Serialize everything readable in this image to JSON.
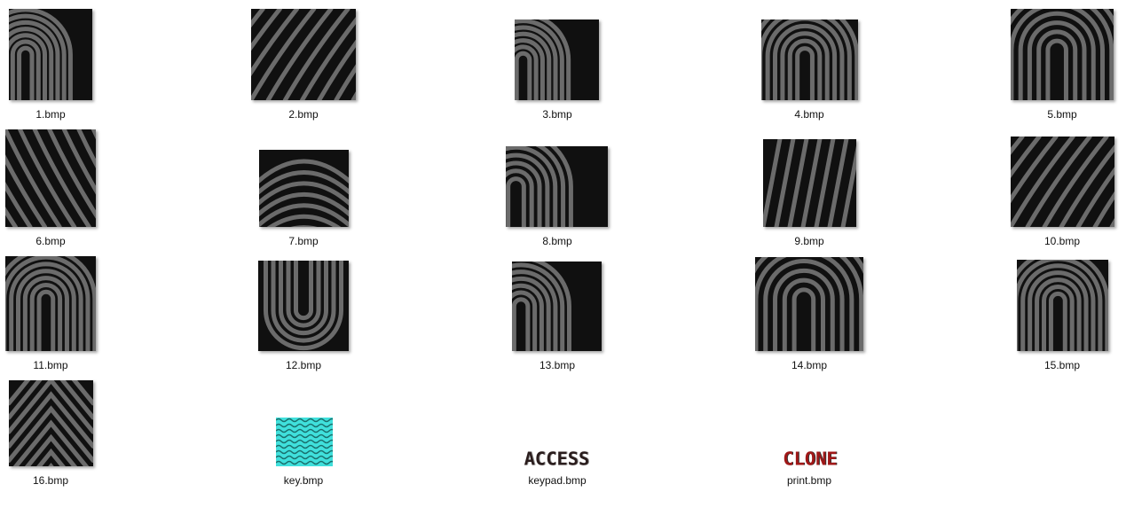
{
  "files": [
    {
      "name": "1.bmp",
      "icon": "fingerprint-icon",
      "pattern": "loop-left"
    },
    {
      "name": "2.bmp",
      "icon": "fingerprint-icon",
      "pattern": "diagonal"
    },
    {
      "name": "3.bmp",
      "icon": "fingerprint-icon",
      "pattern": "arch-right"
    },
    {
      "name": "4.bmp",
      "icon": "fingerprint-icon",
      "pattern": "loop-up"
    },
    {
      "name": "5.bmp",
      "icon": "fingerprint-icon",
      "pattern": "loop-up-wide"
    },
    {
      "name": "6.bmp",
      "icon": "fingerprint-icon",
      "pattern": "diagonal-down"
    },
    {
      "name": "7.bmp",
      "icon": "fingerprint-icon",
      "pattern": "arch"
    },
    {
      "name": "8.bmp",
      "icon": "fingerprint-icon",
      "pattern": "arch-right"
    },
    {
      "name": "9.bmp",
      "icon": "fingerprint-icon",
      "pattern": "split"
    },
    {
      "name": "10.bmp",
      "icon": "fingerprint-icon",
      "pattern": "diagonal"
    },
    {
      "name": "11.bmp",
      "icon": "fingerprint-icon",
      "pattern": "loop-up"
    },
    {
      "name": "12.bmp",
      "icon": "fingerprint-icon",
      "pattern": "loop-down"
    },
    {
      "name": "13.bmp",
      "icon": "fingerprint-icon",
      "pattern": "arch-right"
    },
    {
      "name": "14.bmp",
      "icon": "fingerprint-icon",
      "pattern": "loop-up-wide"
    },
    {
      "name": "15.bmp",
      "icon": "fingerprint-icon",
      "pattern": "loop-up"
    },
    {
      "name": "16.bmp",
      "icon": "fingerprint-icon",
      "pattern": "chevron"
    },
    {
      "name": "key.bmp",
      "icon": "cyan-texture-icon",
      "pattern": "cyan"
    },
    {
      "name": "keypad.bmp",
      "icon": "access-text-image",
      "pattern": "text",
      "text": "ACCESS"
    },
    {
      "name": "print.bmp",
      "icon": "clone-text-image",
      "pattern": "text",
      "text": "CLONE"
    }
  ],
  "colors": {
    "ridge": "#6b6b6b",
    "background": "#101010",
    "cyan": "#40e0dc",
    "text_dark": "#2a1d1d",
    "text_red": "#a01818"
  }
}
